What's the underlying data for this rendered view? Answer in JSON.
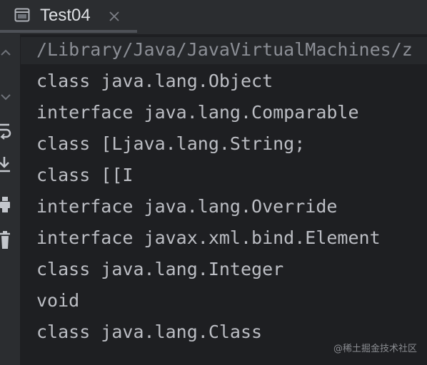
{
  "tab": {
    "title": "Test04",
    "icon": "console-window-icon",
    "close_icon": "close-icon"
  },
  "toolstrip": {
    "items": [
      {
        "name": "scroll-up-icon"
      },
      {
        "name": "scroll-down-icon"
      },
      {
        "name": "soft-wrap-icon"
      },
      {
        "name": "scroll-to-end-icon"
      },
      {
        "name": "print-icon"
      },
      {
        "name": "trash-icon"
      }
    ]
  },
  "console": {
    "path": "/Library/Java/JavaVirtualMachines/z",
    "lines": [
      "class java.lang.Object",
      "interface java.lang.Comparable",
      "class [Ljava.lang.String;",
      "class [[I",
      "interface java.lang.Override",
      "interface javax.xml.bind.Element",
      "class java.lang.Integer",
      "void",
      "class java.lang.Class"
    ]
  },
  "watermark": "@稀土掘金技术社区",
  "colors": {
    "background": "#1e1f22",
    "panel": "#2b2d30",
    "text": "#bcbec4",
    "path_text": "#8c8f96"
  }
}
